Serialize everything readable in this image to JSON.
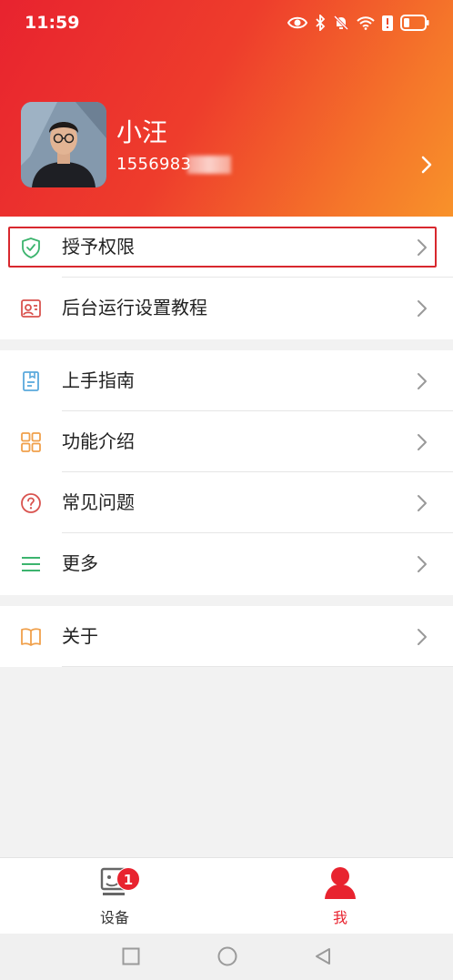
{
  "status_bar": {
    "time": "11:59",
    "icons": [
      "eye-icon",
      "bluetooth-icon",
      "mute-icon",
      "wifi-icon",
      "alert-icon",
      "battery-icon"
    ]
  },
  "profile": {
    "name": "小汪",
    "phone": "1556983"
  },
  "menu": {
    "group1": [
      {
        "label": "授予权限",
        "icon": "shield-check-icon"
      },
      {
        "label": "后台运行设置教程",
        "icon": "profile-card-icon"
      }
    ],
    "group2": [
      {
        "label": "上手指南",
        "icon": "bookmark-doc-icon"
      },
      {
        "label": "功能介绍",
        "icon": "grid-icon"
      },
      {
        "label": "常见问题",
        "icon": "question-icon"
      },
      {
        "label": "更多",
        "icon": "menu-lines-icon"
      }
    ],
    "group3": [
      {
        "label": "关于",
        "icon": "book-icon"
      }
    ]
  },
  "tabbar": {
    "devices_label": "设备",
    "devices_badge": "1",
    "me_label": "我"
  },
  "colors": {
    "accent": "#e8232f",
    "header_gradient_end": "#f8922a",
    "icon_green": "#3cb46e",
    "icon_orange": "#f0a04b",
    "icon_blue": "#5aa9dc",
    "icon_red": "#d9534f"
  }
}
